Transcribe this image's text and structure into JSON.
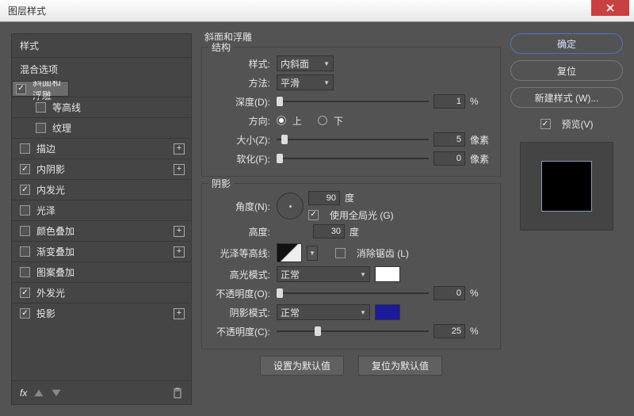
{
  "window": {
    "title": "图层样式"
  },
  "left": {
    "styles_header": "样式",
    "blend_header": "混合选项",
    "effects": [
      {
        "label": "斜面和浮雕",
        "checked": true,
        "selected": true,
        "plus": false,
        "sub": false
      },
      {
        "label": "等高线",
        "checked": false,
        "selected": false,
        "plus": false,
        "sub": true
      },
      {
        "label": "纹理",
        "checked": false,
        "selected": false,
        "plus": false,
        "sub": true
      },
      {
        "label": "描边",
        "checked": false,
        "selected": false,
        "plus": true,
        "sub": false
      },
      {
        "label": "内阴影",
        "checked": true,
        "selected": false,
        "plus": true,
        "sub": false
      },
      {
        "label": "内发光",
        "checked": true,
        "selected": false,
        "plus": false,
        "sub": false
      },
      {
        "label": "光泽",
        "checked": false,
        "selected": false,
        "plus": false,
        "sub": false
      },
      {
        "label": "颜色叠加",
        "checked": false,
        "selected": false,
        "plus": true,
        "sub": false
      },
      {
        "label": "渐变叠加",
        "checked": false,
        "selected": false,
        "plus": true,
        "sub": false
      },
      {
        "label": "图案叠加",
        "checked": false,
        "selected": false,
        "plus": false,
        "sub": false
      },
      {
        "label": "外发光",
        "checked": true,
        "selected": false,
        "plus": false,
        "sub": false
      },
      {
        "label": "投影",
        "checked": true,
        "selected": false,
        "plus": true,
        "sub": false
      }
    ],
    "fx_label": "fx"
  },
  "center": {
    "panel_title": "斜面和浮雕",
    "structure": {
      "title": "结构",
      "style_label": "样式:",
      "style_value": "内斜面",
      "method_label": "方法:",
      "method_value": "平滑",
      "depth_label": "深度(D):",
      "depth_value": "1",
      "depth_unit": "%",
      "dir_label": "方向:",
      "dir_up": "上",
      "dir_down": "下",
      "size_label": "大小(Z):",
      "size_value": "5",
      "size_unit": "像素",
      "soften_label": "软化(F):",
      "soften_value": "0",
      "soften_unit": "像素"
    },
    "shading": {
      "title": "阴影",
      "angle_label": "角度(N):",
      "angle_value": "90",
      "angle_unit": "度",
      "global_label": "使用全局光 (G)",
      "global_checked": true,
      "altitude_label": "高度:",
      "altitude_value": "30",
      "altitude_unit": "度",
      "contour_label": "光泽等高线:",
      "aa_label": "消除锯齿 (L)",
      "aa_checked": false,
      "hl_mode_label": "高光模式:",
      "hl_mode_value": "正常",
      "hl_op_label": "不透明度(O):",
      "hl_op_value": "0",
      "hl_op_unit": "%",
      "sh_mode_label": "阴影模式:",
      "sh_mode_value": "正常",
      "sh_op_label": "不透明度(C):",
      "sh_op_value": "25",
      "sh_op_unit": "%"
    },
    "set_default": "设置为默认值",
    "reset_default": "复位为默认值"
  },
  "right": {
    "ok": "确定",
    "cancel": "复位",
    "new_style": "新建样式 (W)...",
    "preview_label": "预览(V)",
    "preview_checked": true
  }
}
